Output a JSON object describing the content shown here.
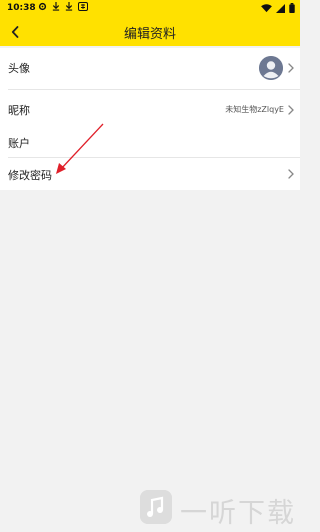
{
  "status_bar": {
    "time": "10:38",
    "icons": [
      "settings-icon",
      "download-icon",
      "download-icon",
      "app-badge-icon",
      "wifi-icon",
      "signal-icon",
      "battery-icon"
    ]
  },
  "header": {
    "title": "编辑资料",
    "background": "#ffe100",
    "back_icon": "chevron-left-icon"
  },
  "profile_section": {
    "avatar_label": "头像",
    "nickname_label": "昵称",
    "nickname_value": "未知生物zZlqyE"
  },
  "account_section": {
    "heading": "账户",
    "change_password_label": "修改密码"
  },
  "annotation": {
    "color": "#e0202a",
    "icon": "red-arrow-pointing-to-change-password"
  },
  "watermark": {
    "text": "一听下载",
    "logo_icon": "music-note-logo"
  }
}
